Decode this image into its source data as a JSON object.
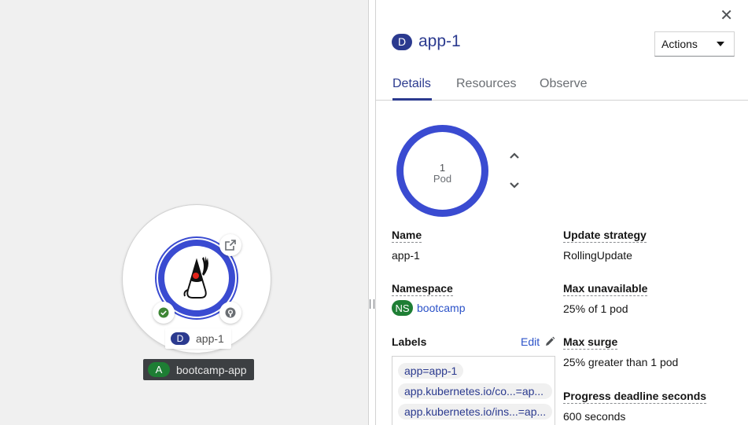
{
  "topology": {
    "node_label": "app-1",
    "node_badge": "D",
    "group_label": "bootcamp-app",
    "group_badge": "A",
    "runtime_icon": "java-duke-icon",
    "status_icon": "check-circle-icon",
    "route_icon": "external-link-icon",
    "source_icon": "github-icon"
  },
  "panel": {
    "close_icon": "close-icon",
    "badge": "D",
    "title": "app-1",
    "actions_label": "Actions",
    "tabs": [
      {
        "label": "Details",
        "active": true
      },
      {
        "label": "Resources",
        "active": false
      },
      {
        "label": "Observe",
        "active": false
      }
    ],
    "pods": {
      "count": "1",
      "unit": "Pod"
    },
    "details": {
      "name_label": "Name",
      "name_value": "app-1",
      "namespace_label": "Namespace",
      "namespace_badge": "NS",
      "namespace_value": "bootcamp",
      "labels_label": "Labels",
      "edit_label": "Edit",
      "labels": [
        "app=app-1",
        "app.kubernetes.io/co...=ap...",
        "app.kubernetes.io/ins...=ap..."
      ],
      "update_strategy_label": "Update strategy",
      "update_strategy_value": "RollingUpdate",
      "max_unavailable_label": "Max unavailable",
      "max_unavailable_value": "25% of 1 pod",
      "max_surge_label": "Max surge",
      "max_surge_value": "25% greater than 1 pod",
      "progress_deadline_label": "Progress deadline seconds",
      "progress_deadline_value": "600 seconds"
    }
  },
  "colors": {
    "accent": "#2b3a8f",
    "ring": "#3a4bd1",
    "link": "#2b52c8",
    "success": "#1e7e34"
  }
}
